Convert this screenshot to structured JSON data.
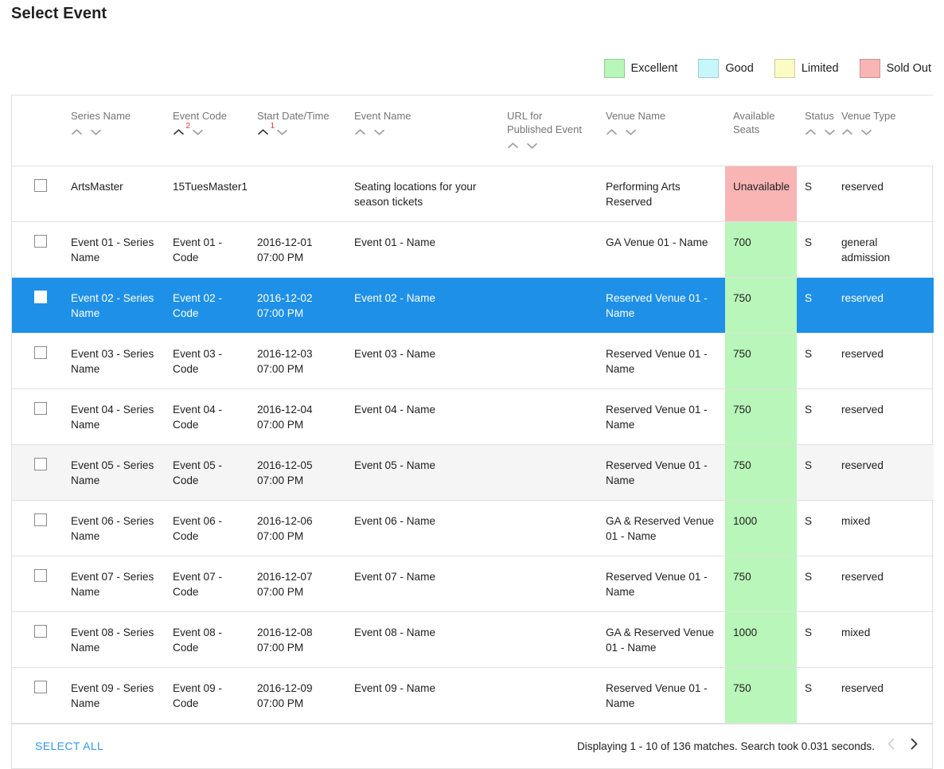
{
  "page": {
    "title": "Select Event"
  },
  "legend": {
    "items": [
      {
        "label": "Excellent",
        "color": "#b9f6b9",
        "key": "excellent"
      },
      {
        "label": "Good",
        "color": "#c6f7fb",
        "key": "good"
      },
      {
        "label": "Limited",
        "color": "#fbfbc4",
        "key": "limited"
      },
      {
        "label": "Sold Out",
        "color": "#f9b4b4",
        "key": "soldout"
      }
    ]
  },
  "table": {
    "columns": [
      {
        "key": "select",
        "label": "",
        "sortable": false
      },
      {
        "key": "series",
        "label": "Series Name",
        "sortable": true,
        "sort_rank": ""
      },
      {
        "key": "code",
        "label": "Event Code",
        "sortable": true,
        "sort_rank": "2"
      },
      {
        "key": "date",
        "label": "Start Date/Time",
        "sortable": true,
        "sort_rank": "1"
      },
      {
        "key": "event_name",
        "label": "Event Name",
        "sortable": true,
        "sort_rank": ""
      },
      {
        "key": "url",
        "label": "URL for Published Event",
        "sortable": true,
        "sort_rank": ""
      },
      {
        "key": "venue",
        "label": "Venue Name",
        "sortable": true,
        "sort_rank": ""
      },
      {
        "key": "seats",
        "label": "Available Seats",
        "sortable": false,
        "sort_rank": ""
      },
      {
        "key": "status",
        "label": "Status",
        "sortable": true,
        "sort_rank": ""
      },
      {
        "key": "venue_type",
        "label": "Venue Type",
        "sortable": true,
        "sort_rank": ""
      }
    ],
    "rows": [
      {
        "series": "ArtsMaster",
        "code": "15TuesMaster1",
        "date": "",
        "event_name": "Seating locations for your season tickets",
        "url": "",
        "venue": "Performing Arts Reserved",
        "seats": "Unavailable",
        "seats_level": "soldout",
        "status": "S",
        "venue_type": "reserved",
        "state": "normal"
      },
      {
        "series": "Event 01 - Series Name",
        "code": "Event 01 - Code",
        "date": "2016-12-01 07:00 PM",
        "event_name": "Event 01 - Name",
        "url": "",
        "venue": "GA Venue 01 - Name",
        "seats": "700",
        "seats_level": "excellent",
        "status": "S",
        "venue_type": "general admission",
        "state": "normal"
      },
      {
        "series": "Event 02 - Series Name",
        "code": "Event 02 - Code",
        "date": "2016-12-02 07:00 PM",
        "event_name": "Event 02 - Name",
        "url": "",
        "venue": "Reserved Venue 01 - Name",
        "seats": "750",
        "seats_level": "excellent",
        "status": "S",
        "venue_type": "reserved",
        "state": "selected"
      },
      {
        "series": "Event 03 - Series Name",
        "code": "Event 03 - Code",
        "date": "2016-12-03 07:00 PM",
        "event_name": "Event 03 - Name",
        "url": "",
        "venue": "Reserved Venue 01 - Name",
        "seats": "750",
        "seats_level": "excellent",
        "status": "S",
        "venue_type": "reserved",
        "state": "normal"
      },
      {
        "series": "Event 04 - Series Name",
        "code": "Event 04 - Code",
        "date": "2016-12-04 07:00 PM",
        "event_name": "Event 04 - Name",
        "url": "",
        "venue": "Reserved Venue 01 - Name",
        "seats": "750",
        "seats_level": "excellent",
        "status": "S",
        "venue_type": "reserved",
        "state": "normal"
      },
      {
        "series": "Event 05 - Series Name",
        "code": "Event 05 - Code",
        "date": "2016-12-05 07:00 PM",
        "event_name": "Event 05 - Name",
        "url": "",
        "venue": "Reserved Venue 01 - Name",
        "seats": "750",
        "seats_level": "excellent",
        "status": "S",
        "venue_type": "reserved",
        "state": "hover"
      },
      {
        "series": "Event 06 - Series Name",
        "code": "Event 06 - Code",
        "date": "2016-12-06 07:00 PM",
        "event_name": "Event 06 - Name",
        "url": "",
        "venue": "GA & Reserved Venue 01 - Name",
        "seats": "1000",
        "seats_level": "excellent",
        "status": "S",
        "venue_type": "mixed",
        "state": "normal"
      },
      {
        "series": "Event 07 - Series Name",
        "code": "Event 07 - Code",
        "date": "2016-12-07 07:00 PM",
        "event_name": "Event 07 - Name",
        "url": "",
        "venue": "Reserved Venue 01 - Name",
        "seats": "750",
        "seats_level": "excellent",
        "status": "S",
        "venue_type": "reserved",
        "state": "normal"
      },
      {
        "series": "Event 08 - Series Name",
        "code": "Event 08 - Code",
        "date": "2016-12-08 07:00 PM",
        "event_name": "Event 08 - Name",
        "url": "",
        "venue": "GA & Reserved Venue 01 - Name",
        "seats": "1000",
        "seats_level": "excellent",
        "status": "S",
        "venue_type": "mixed",
        "state": "normal"
      },
      {
        "series": "Event 09 - Series Name",
        "code": "Event 09 - Code",
        "date": "2016-12-09 07:00 PM",
        "event_name": "Event 09 - Name",
        "url": "",
        "venue": "Reserved Venue 01 - Name",
        "seats": "750",
        "seats_level": "excellent",
        "status": "S",
        "venue_type": "reserved",
        "state": "normal"
      }
    ]
  },
  "footer": {
    "select_all_label": "SELECT ALL",
    "status_text": "Displaying 1 - 10 of 136 matches. Search took 0.031 seconds.",
    "prev_icon": "chevron-left-icon",
    "next_icon": "chevron-right-icon",
    "prev_enabled": false,
    "next_enabled": true
  },
  "colors": {
    "selected_row": "#1e90e8",
    "link": "#3596f2",
    "sort_rank": "#e53935",
    "border": "#e0e0e0"
  }
}
